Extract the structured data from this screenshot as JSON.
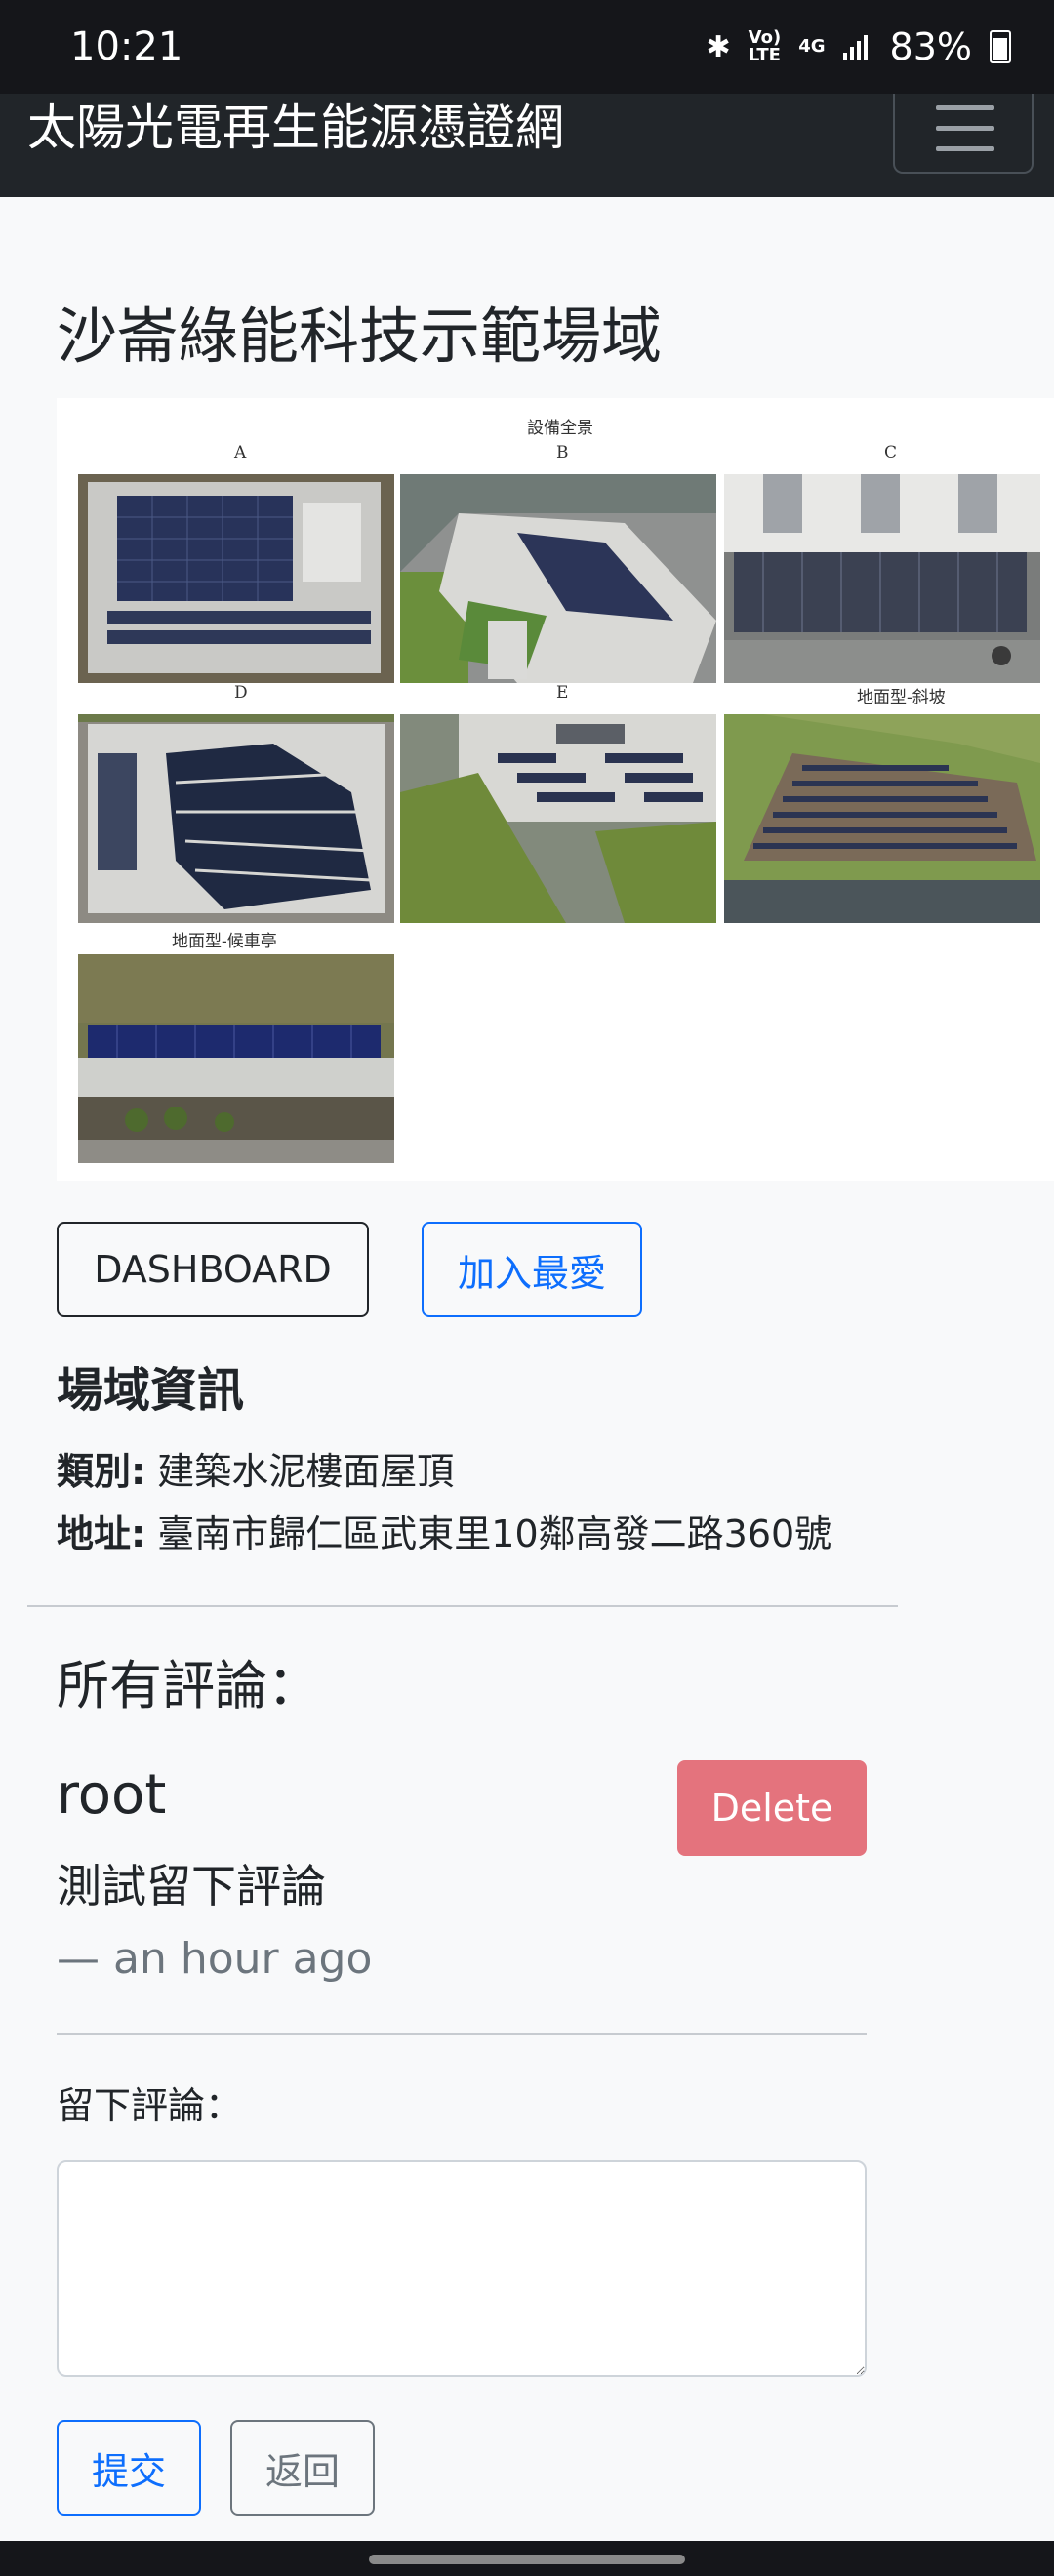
{
  "status_bar": {
    "time": "10:21",
    "battery": "83%",
    "volte_line1": "Vo)",
    "volte_line2": "LTE",
    "network": "4G"
  },
  "navbar": {
    "brand": "太陽光電再生能源憑證網"
  },
  "site": {
    "title": "沙崙綠能科技示範場域",
    "figure": {
      "caption": "設備全景",
      "labels": [
        "A",
        "B",
        "C",
        "D",
        "E",
        "地面型-斜坡",
        "地面型-候車亭"
      ]
    }
  },
  "actions": {
    "dashboard": "DASHBOARD",
    "favorite": "加入最愛"
  },
  "info": {
    "heading": "場域資訊",
    "category_label": "類別:",
    "category_value": "建築水泥樓面屋頂",
    "address_label": "地址:",
    "address_value": "臺南市歸仁區武東里10鄰高發二路360號"
  },
  "comments": {
    "heading": "所有評論：",
    "items": [
      {
        "user": "root",
        "text": "測試留下評論",
        "time": "— an hour ago",
        "delete_label": "Delete"
      }
    ]
  },
  "form": {
    "label": "留下評論：",
    "placeholder": "",
    "submit": "提交",
    "back": "返回"
  },
  "colors": {
    "primary": "#0d6efd",
    "danger": "#e4737d",
    "navbar": "#212529",
    "status_bar": "#15161a"
  }
}
